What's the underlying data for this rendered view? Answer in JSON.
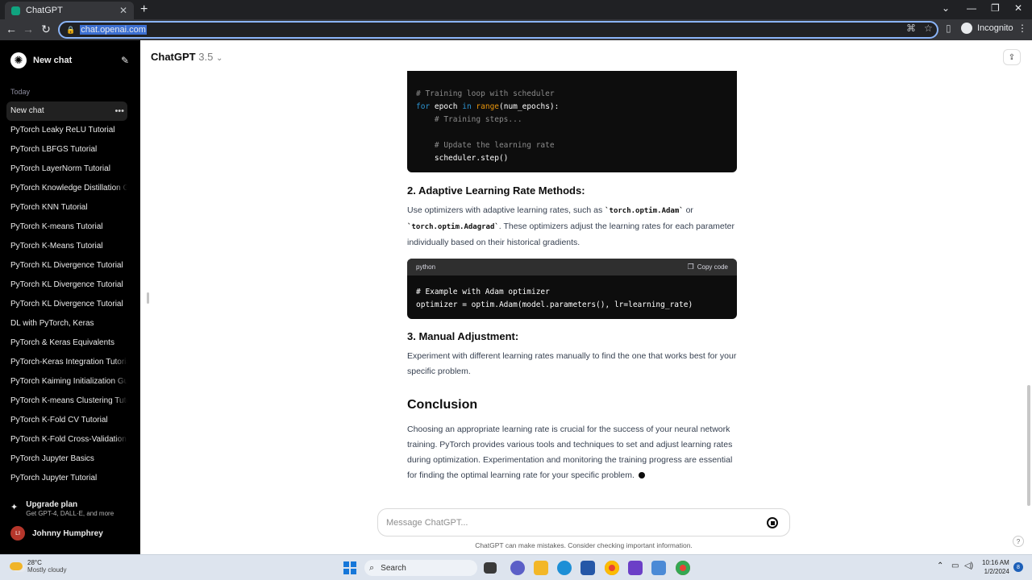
{
  "browser": {
    "tab_title": "ChatGPT",
    "tab_close": "✕",
    "new_tab": "+",
    "url": "chat.openai.com",
    "incognito_label": "Incognito"
  },
  "sidebar": {
    "new_chat_label": "New chat",
    "section_label": "Today",
    "items": [
      {
        "label": "New chat"
      },
      {
        "label": "PyTorch Leaky ReLU Tutorial"
      },
      {
        "label": "PyTorch LBFGS Tutorial"
      },
      {
        "label": "PyTorch LayerNorm Tutorial"
      },
      {
        "label": "PyTorch Knowledge Distillation G"
      },
      {
        "label": "PyTorch KNN Tutorial"
      },
      {
        "label": "PyTorch K-means Tutorial"
      },
      {
        "label": "PyTorch K-Means Tutorial"
      },
      {
        "label": "PyTorch KL Divergence Tutorial"
      },
      {
        "label": "PyTorch KL Divergence Tutorial"
      },
      {
        "label": "PyTorch KL Divergence Tutorial"
      },
      {
        "label": "DL with PyTorch, Keras"
      },
      {
        "label": "PyTorch & Keras Equivalents"
      },
      {
        "label": "PyTorch-Keras Integration Tutoria"
      },
      {
        "label": "PyTorch Kaiming Initialization Gu"
      },
      {
        "label": "PyTorch K-means Clustering Tuto"
      },
      {
        "label": "PyTorch K-Fold CV Tutorial"
      },
      {
        "label": "PyTorch K-Fold Cross-Validation T"
      },
      {
        "label": "PyTorch Jupyter Basics"
      },
      {
        "label": "PyTorch Jupyter Tutorial"
      }
    ],
    "upgrade_title": "Upgrade plan",
    "upgrade_sub": "Get GPT-4, DALL·E, and more",
    "user_initials": "LI",
    "user_name": "Johnny Humphrey"
  },
  "header": {
    "model_name": "ChatGPT",
    "model_version": "3.5",
    "chevron": "⌄"
  },
  "content": {
    "code1": {
      "partial": "                           ",
      "line1": "# Training loop with scheduler",
      "line2_kw1": "for",
      "line2_a": " epoch ",
      "line2_kw2": "in",
      "line2_b": " ",
      "line2_fn": "range",
      "line2_c": "(num_epochs):",
      "line3": "    # Training steps...",
      "line4": "    # Update the learning rate",
      "line5": "    scheduler.step()"
    },
    "section2_heading": "2. Adaptive Learning Rate Methods:",
    "section2_p1": "Use optimizers with adaptive learning rates, such as ",
    "section2_code1": "`torch.optim.Adam`",
    "section2_p2": " or ",
    "section2_code2": "`torch.optim.Adagrad`",
    "section2_p3": ". These optimizers adjust the learning rates for each parameter individually based on their historical gradients.",
    "code2": {
      "language": "python",
      "copy_label": "Copy code",
      "line1": "# Example with Adam optimizer",
      "line2": "optimizer = optim.Adam(model.parameters(), lr=learning_rate)"
    },
    "section3_heading": "3. Manual Adjustment:",
    "section3_text": "Experiment with different learning rates manually to find the one that works best for your specific problem.",
    "conclusion_heading": "Conclusion",
    "conclusion_text": "Choosing an appropriate learning rate is crucial for the success of your neural network training. PyTorch provides various tools and techniques to set and adjust learning rates during optimization. Experimentation and monitoring the training progress are essential for finding the optimal learning rate for your specific problem."
  },
  "composer": {
    "placeholder": "Message ChatGPT...",
    "disclaimer": "ChatGPT can make mistakes. Consider checking important information."
  },
  "taskbar": {
    "temperature": "28°C",
    "weather": "Mostly cloudy",
    "search_label": "Search",
    "time": "10:16 AM",
    "date": "1/2/2024",
    "notification_count": "8"
  },
  "colors": {
    "sidebar_bg": "#000000",
    "code_bg": "#0d0d0d",
    "accent": "#10a37f",
    "omnibox_focus": "#8ab4f8"
  }
}
